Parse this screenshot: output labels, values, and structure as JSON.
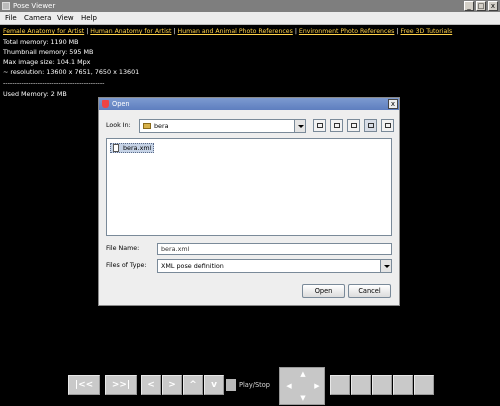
{
  "window": {
    "title": "Pose Viewer",
    "minimize": "_",
    "maximize": "□",
    "close": "x"
  },
  "menu": [
    "File",
    "Camera",
    "View",
    "Help"
  ],
  "links": [
    "Female Anatomy for Artist",
    "Human Anatomy for Artist",
    "Human and Animal Photo References",
    "Environment Photo References",
    "Free 3D Tutorials"
  ],
  "link_separator": "|",
  "info": {
    "total_memory": "Total memory:  1190 MB",
    "thumbnail_memory": "Thumbnail memory:  595 MB",
    "max_image_size": "Max image size: 104.1 Mpx",
    "resolution": "~ resolution: 13600 x 7651,   7650 x 13601",
    "divider": "--------------------------------------------",
    "used_memory": "Used Memory:  2 MB"
  },
  "dialog": {
    "title": "Open",
    "close": "x",
    "look_in_label": "Look In:",
    "look_in_value": "bera",
    "files": [
      "bera.xml"
    ],
    "file_name_label": "File Name:",
    "file_name_value": "bera.xml",
    "files_of_type_label": "Files of Type:",
    "files_of_type_value": "XML pose definition",
    "open_button": "Open",
    "cancel_button": "Cancel"
  },
  "toolbar": {
    "first": "|<<",
    "last": ">>|",
    "prev": "<",
    "next": ">",
    "up": "^",
    "down": "v",
    "play_stop": "Play/Stop",
    "nav": {
      "up": "▲",
      "down": "▼",
      "left": "◀",
      "right": "▶"
    }
  },
  "colors": {
    "background": "#000000",
    "link": "#ffd24a",
    "dialog_title": "#6a88c6"
  }
}
